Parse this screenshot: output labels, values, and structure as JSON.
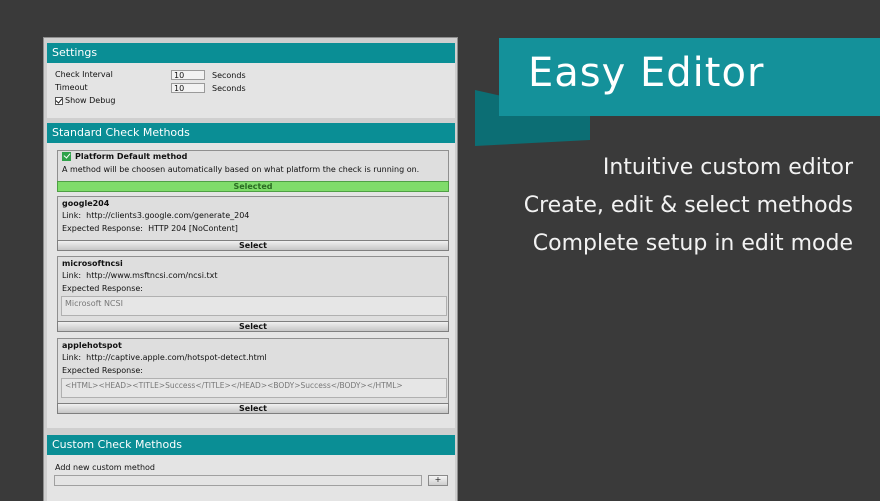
{
  "settings": {
    "header": "Settings",
    "check_interval_label": "Check Interval",
    "check_interval_value": "10",
    "check_interval_unit": "Seconds",
    "timeout_label": "Timeout",
    "timeout_value": "10",
    "timeout_unit": "Seconds",
    "show_debug_label": "Show Debug",
    "show_debug_checked": true
  },
  "standard": {
    "header": "Standard Check Methods",
    "platform": {
      "title": "Platform Default method",
      "description": "A method will be choosen automatically based on what platform the check is running on.",
      "selected_label": "Selected"
    },
    "methods": [
      {
        "name": "google204",
        "link_label": "Link:",
        "link": "http://clients3.google.com/generate_204",
        "response_label": "Expected Response:",
        "response": "HTTP 204 [NoContent]",
        "button": "Select"
      },
      {
        "name": "microsoftncsi",
        "link_label": "Link:",
        "link": "http://www.msftncsi.com/ncsi.txt",
        "response_label": "Expected Response:",
        "response": "Microsoft NCSI",
        "button": "Select"
      },
      {
        "name": "applehotspot",
        "link_label": "Link:",
        "link": "http://captive.apple.com/hotspot-detect.html",
        "response_label": "Expected Response:",
        "response": "<HTML><HEAD><TITLE>Success</TITLE></HEAD><BODY>Success</BODY></HTML>",
        "button": "Select"
      }
    ]
  },
  "custom": {
    "header": "Custom Check Methods",
    "add_label": "Add new custom method",
    "add_button": "+",
    "input_value": ""
  },
  "banner": {
    "title": "Easy Editor",
    "lines": [
      "Intuitive custom editor",
      "Create, edit & select methods",
      "Complete setup in edit mode"
    ],
    "accent_color": "#14919a",
    "fold_color": "#0c6e74"
  },
  "colors": {
    "background": "#3a3a3a",
    "section_header": "#0a8e95",
    "selected_green": "#7fdc6a"
  }
}
